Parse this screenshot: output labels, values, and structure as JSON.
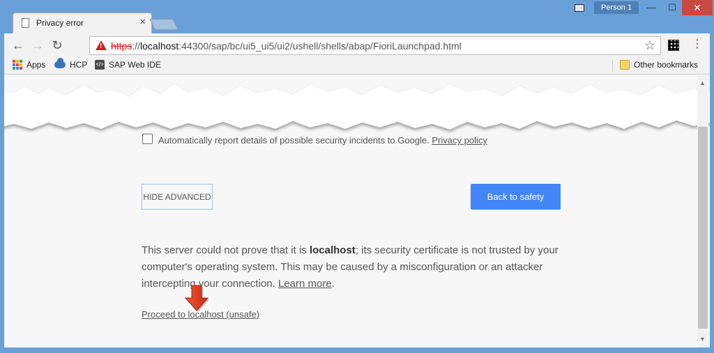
{
  "window": {
    "tab_title": "Privacy error",
    "tab_close": "×",
    "profile": "Person 1",
    "minimize": "—",
    "maximize": "☐",
    "close": "✕"
  },
  "toolbar": {
    "back": "←",
    "forward": "→",
    "reload": "↻",
    "home": "⌂",
    "url_scheme": "https",
    "url_sep": "://",
    "url_host": "localhost",
    "url_rest": ":44300/sap/bc/ui5_ui5/ui2/ushell/shells/abap/FioriLaunchpad.html",
    "star": "☆",
    "menu": "⋮"
  },
  "bookmarks": [
    {
      "label": "Apps",
      "icon": "apps-grid-icon"
    },
    {
      "label": "HCP",
      "icon": "cloud-icon"
    },
    {
      "label": "SAP Web IDE",
      "icon": "web-ide-icon"
    },
    {
      "label": "Other bookmarks",
      "icon": "folder-icon"
    }
  ],
  "content": {
    "checkbox_text": "Automatically report details of possible security incidents to Google.",
    "privacy_link": "Privacy policy",
    "hide_advanced": "HIDE ADVANCED",
    "back_to_safety": "Back to safety",
    "explain_1": "This server could not prove that it is ",
    "explain_host": "localhost",
    "explain_2": "; its security certificate is not trusted by your computer's operating system. This may be caused by a misconfiguration or an attacker intercepting your connection. ",
    "learn_more": "Learn more",
    "period": ".",
    "proceed": "Proceed to localhost (unsafe)"
  },
  "colors": {
    "frame": "#6aa0d8",
    "primary_button": "#4285f4",
    "warning": "#c5221f",
    "annotation_arrow": "#d9391f"
  }
}
